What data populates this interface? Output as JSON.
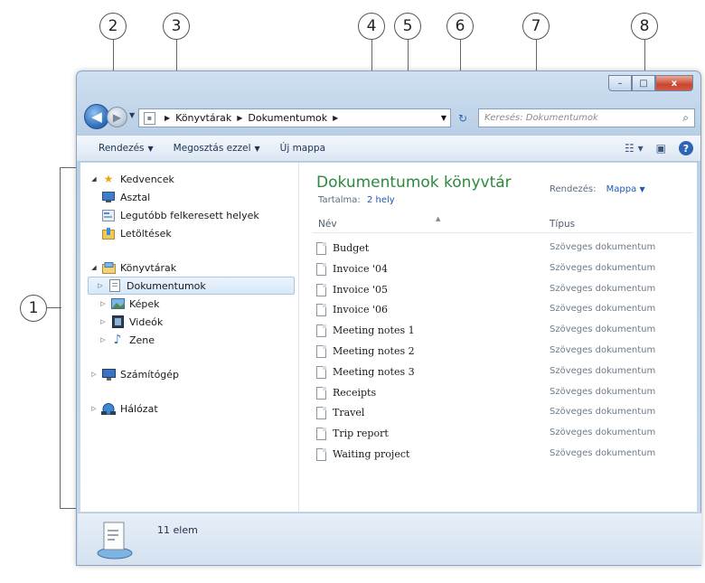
{
  "callouts": [
    "1",
    "2",
    "3",
    "4",
    "5",
    "6",
    "7",
    "8"
  ],
  "window": {
    "buttons": {
      "minimize": "–",
      "maximize": "□",
      "close": "x"
    }
  },
  "navbar": {
    "back_glyph": "◀",
    "forward_glyph": "▶",
    "address": [
      "Könyvtárak",
      "Dokumentumok"
    ],
    "search_placeholder": "Keresés: Dokumentumok"
  },
  "toolbar": {
    "organize": "Rendezés",
    "share": "Megosztás ezzel",
    "new_folder": "Új mappa"
  },
  "navpane": {
    "favorites": {
      "label": "Kedvencek",
      "items": [
        "Asztal",
        "Legutóbb felkeresett helyek",
        "Letöltések"
      ]
    },
    "libraries": {
      "label": "Könyvtárak",
      "items": [
        "Dokumentumok",
        "Képek",
        "Videók",
        "Zene"
      ],
      "selected": "Dokumentumok"
    },
    "computer": "Számítógép",
    "network": "Hálózat"
  },
  "library": {
    "title": "Dokumentumok könyvtár",
    "includes_label": "Tartalma:",
    "includes_value": "2 hely",
    "arrange_label": "Rendezés:",
    "arrange_value": "Mappa"
  },
  "columns": {
    "name": "Név",
    "type": "Típus"
  },
  "files": [
    {
      "name": "Budget",
      "type": "Szöveges dokumentum"
    },
    {
      "name": "Invoice '04",
      "type": "Szöveges dokumentum"
    },
    {
      "name": "Invoice '05",
      "type": "Szöveges dokumentum"
    },
    {
      "name": "Invoice '06",
      "type": "Szöveges dokumentum"
    },
    {
      "name": "Meeting notes 1",
      "type": "Szöveges dokumentum"
    },
    {
      "name": "Meeting notes 2",
      "type": "Szöveges dokumentum"
    },
    {
      "name": "Meeting notes 3",
      "type": "Szöveges dokumentum"
    },
    {
      "name": "Receipts",
      "type": "Szöveges dokumentum"
    },
    {
      "name": "Travel",
      "type": "Szöveges dokumentum"
    },
    {
      "name": "Trip report",
      "type": "Szöveges dokumentum"
    },
    {
      "name": "Waiting project",
      "type": "Szöveges dokumentum"
    }
  ],
  "status": {
    "count": "11 elem"
  },
  "icons": {
    "favorites": "star-icon",
    "desktop": "desktop-icon",
    "recent": "recent-places-icon",
    "downloads": "downloads-folder-icon",
    "libraries": "libraries-icon",
    "documents": "documents-icon",
    "pictures": "pictures-icon",
    "videos": "videos-icon",
    "music": "music-icon",
    "computer": "computer-icon",
    "network": "network-icon",
    "file": "text-document-icon"
  },
  "colors": {
    "library_title": "#2b8a3e",
    "link": "#1e5bb5",
    "selection": "#d9e8f8"
  }
}
